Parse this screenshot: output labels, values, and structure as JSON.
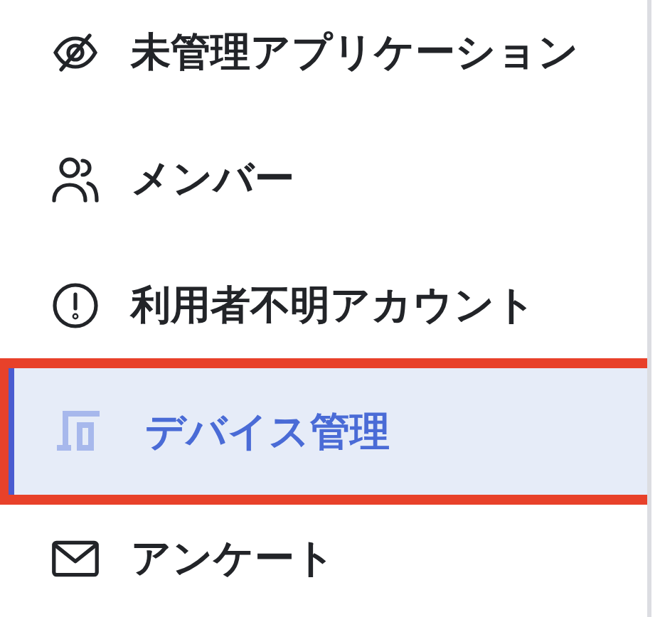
{
  "menu": {
    "items": [
      {
        "label": "未管理アプリケーション",
        "selected": false,
        "highlighted": false
      },
      {
        "label": "メンバー",
        "selected": false,
        "highlighted": false
      },
      {
        "label": "利用者不明アカウント",
        "selected": false,
        "highlighted": false
      },
      {
        "label": "デバイス管理",
        "selected": true,
        "highlighted": true
      },
      {
        "label": "アンケート",
        "selected": false,
        "highlighted": false
      }
    ]
  }
}
